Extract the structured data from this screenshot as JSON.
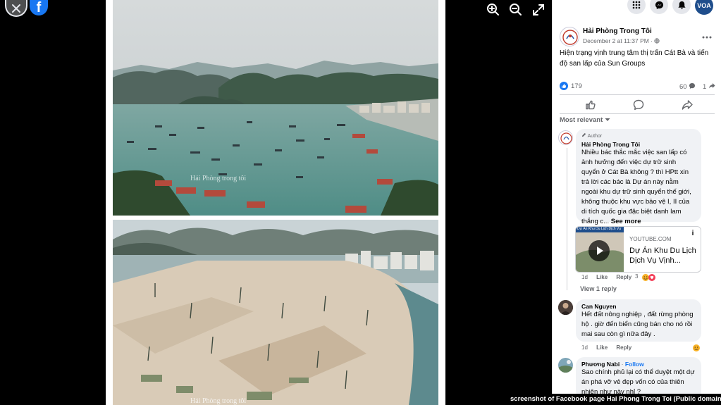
{
  "viewer": {
    "close_icon": "close-icon",
    "brand_icon": "facebook-logo",
    "brand_letter": "f",
    "tools": [
      "zoom-in-icon",
      "zoom-out-icon",
      "fullscreen-icon"
    ],
    "watermark_top": "Hải Phòng trong tôi",
    "watermark_bottom": "Hải Phòng trong tôi"
  },
  "topbar": {
    "icons": [
      "menu-grid-icon",
      "messenger-icon",
      "notifications-icon"
    ],
    "account_label": "VOA"
  },
  "post": {
    "page_name": "Hải Phòng Trong Tôi",
    "timestamp": "December 2 at 11:37 PM ·",
    "privacy_icon": "globe-icon",
    "text": "Hiện trạng vịnh trung tâm thị trấn Cát Bà và tiến độ san lấp của Sun Groups",
    "reactions_count": "179",
    "comments_count": "60",
    "shares_count": "1",
    "relevance_label": "Most relevant"
  },
  "comments": [
    {
      "author_tag": "Author",
      "author": "Hải Phòng Trong Tôi",
      "text": "Nhiều bác thắc mắc việc san lấp có ảnh hưởng đến việc dự trữ sinh quyển ở Cát Bà không ? thì HPtt xin trả lời các bác là Dự án này nằm ngoài khu dự trữ sinh quyển thế giới, không thuộc khu vực bảo vệ I, II của di tích quốc gia đặc biệt danh lam thắng c...",
      "see_more": "See more",
      "time": "1d",
      "like": "Like",
      "reply": "Reply",
      "reaction_count": "3",
      "link": {
        "thumb_text": "Dự Án Khu Du Lịch Dịch Vụ Vịnh Trung Tâm C",
        "source": "YOUTUBE.COM",
        "title": "Dự Án Khu Du Lịch Dịch Vụ Vịnh..."
      },
      "view_replies": "View 1 reply"
    },
    {
      "author": "Can Nguyen",
      "text": "Hết đất nông nghiệp , đất rừng phòng hộ . giờ đến biển cũng bán cho nó rồi mai sau còn gì nữa đây .",
      "time": "1d",
      "like": "Like",
      "reply": "Reply"
    },
    {
      "author": "Phương Nabi",
      "follow": "Follow",
      "text": "Sao chính phủ lại có thể duyệt một dự án phá vỡ vẻ đẹp vốn có của thiên nhiên như này nhỉ ?"
    }
  ],
  "credit": "screenshot of Facebook page Hai Phong Trong Toi (Public domain)",
  "colors": {
    "accent": "#1877f2",
    "bubble": "#f0f2f5",
    "muted_text": "#65676b",
    "badge": "#e41e3f"
  }
}
